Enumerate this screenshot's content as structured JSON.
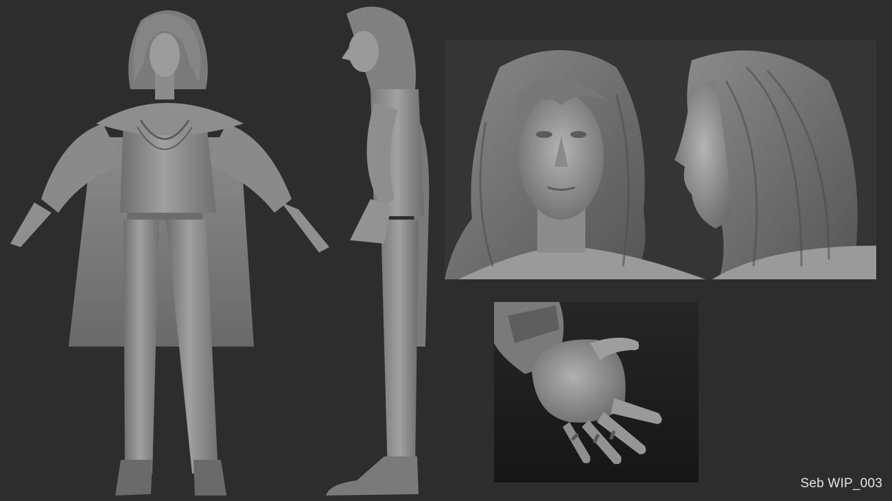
{
  "caption": "Seb WIP_003",
  "colors": {
    "background": "#2d2d2d",
    "clay_light": "#9a9a9a",
    "clay_mid": "#7c7c7c",
    "clay_dark": "#5a5a5a",
    "head_panel_bg": "#353535",
    "hand_panel_bg": "#232323"
  },
  "panels": {
    "front_view": "front-full-body-sculpt",
    "side_view": "side-full-body-sculpt",
    "head_closeup": "head-front-and-profile-sculpt",
    "hand_closeup": "hand-palm-sculpt"
  }
}
